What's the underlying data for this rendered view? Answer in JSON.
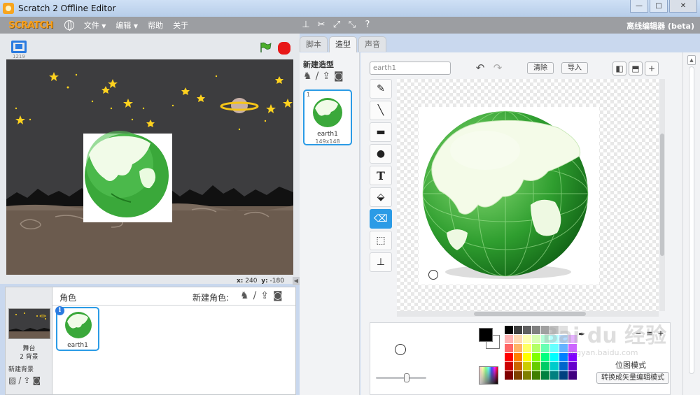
{
  "window": {
    "title": "Scratch 2 Offline Editor",
    "minimize": "—",
    "maximize": "□",
    "close": "✕"
  },
  "menubar": {
    "logo": "SCRATCH",
    "file": "文件",
    "edit": "编辑",
    "help": "帮助",
    "about": "关于",
    "mode": "离线编辑器 (beta)",
    "tool_icons": [
      "stamp-icon",
      "cut-icon",
      "grow-icon",
      "shrink-icon",
      "help-icon"
    ]
  },
  "stage": {
    "version": "1219",
    "x_label": "x:",
    "x_value": "240",
    "y_label": "y:",
    "y_value": "-180"
  },
  "sprite_panel": {
    "title": "角色",
    "new_sprite_label": "新建角色:",
    "stage_label": "舞台",
    "stage_backdrops": "2 背景",
    "new_backdrop_label": "新建背景",
    "sprites": [
      {
        "name": "earth1",
        "info": "i"
      }
    ]
  },
  "tabs": [
    {
      "label": "脚本"
    },
    {
      "label": "造型"
    },
    {
      "label": "声音"
    }
  ],
  "costume_list": {
    "new_costume_label": "新建造型",
    "costumes": [
      {
        "num": "1",
        "name": "earth1",
        "size": "149x148"
      }
    ]
  },
  "editor": {
    "costume_name_value": "earth1",
    "clear_label": "清除",
    "import_label": "导入",
    "tools": [
      "brush-icon",
      "line-icon",
      "rectangle-icon",
      "ellipse-icon",
      "text-icon",
      "fill-icon",
      "eraser-icon",
      "select-icon",
      "stamp-icon"
    ],
    "selected_tool": "eraser-icon",
    "bitmap_mode_label": "位图模式",
    "convert_label": "转换成矢量编辑模式",
    "zoom_out": "−",
    "zoom_reset": "=",
    "zoom_in": "+",
    "primary_color": "#000000",
    "secondary_color": "#ffffff",
    "palette": [
      "#000000",
      "#404040",
      "#606060",
      "#808080",
      "#a0a0a0",
      "#c0c0c0",
      "#e0e0e0",
      "#ffffff",
      "#ffb3b3",
      "#ffd9b3",
      "#ffffb3",
      "#d9ffb3",
      "#b3ffd9",
      "#b3ffff",
      "#b3d9ff",
      "#e6b3ff",
      "#ff6666",
      "#ffb366",
      "#ffff66",
      "#b3ff66",
      "#66ffb3",
      "#66ffff",
      "#66b3ff",
      "#cc66ff",
      "#ff0000",
      "#ff8000",
      "#ffff00",
      "#80ff00",
      "#00ff80",
      "#00ffff",
      "#0080ff",
      "#8000ff",
      "#cc0000",
      "#cc6600",
      "#cccc00",
      "#66cc00",
      "#00cc66",
      "#00cccc",
      "#0066cc",
      "#6600cc",
      "#800000",
      "#804000",
      "#808000",
      "#408000",
      "#008040",
      "#008080",
      "#004080",
      "#400080"
    ]
  },
  "watermark": {
    "text": "Bai du 经验",
    "sub": "jingyan.baidu.com"
  }
}
